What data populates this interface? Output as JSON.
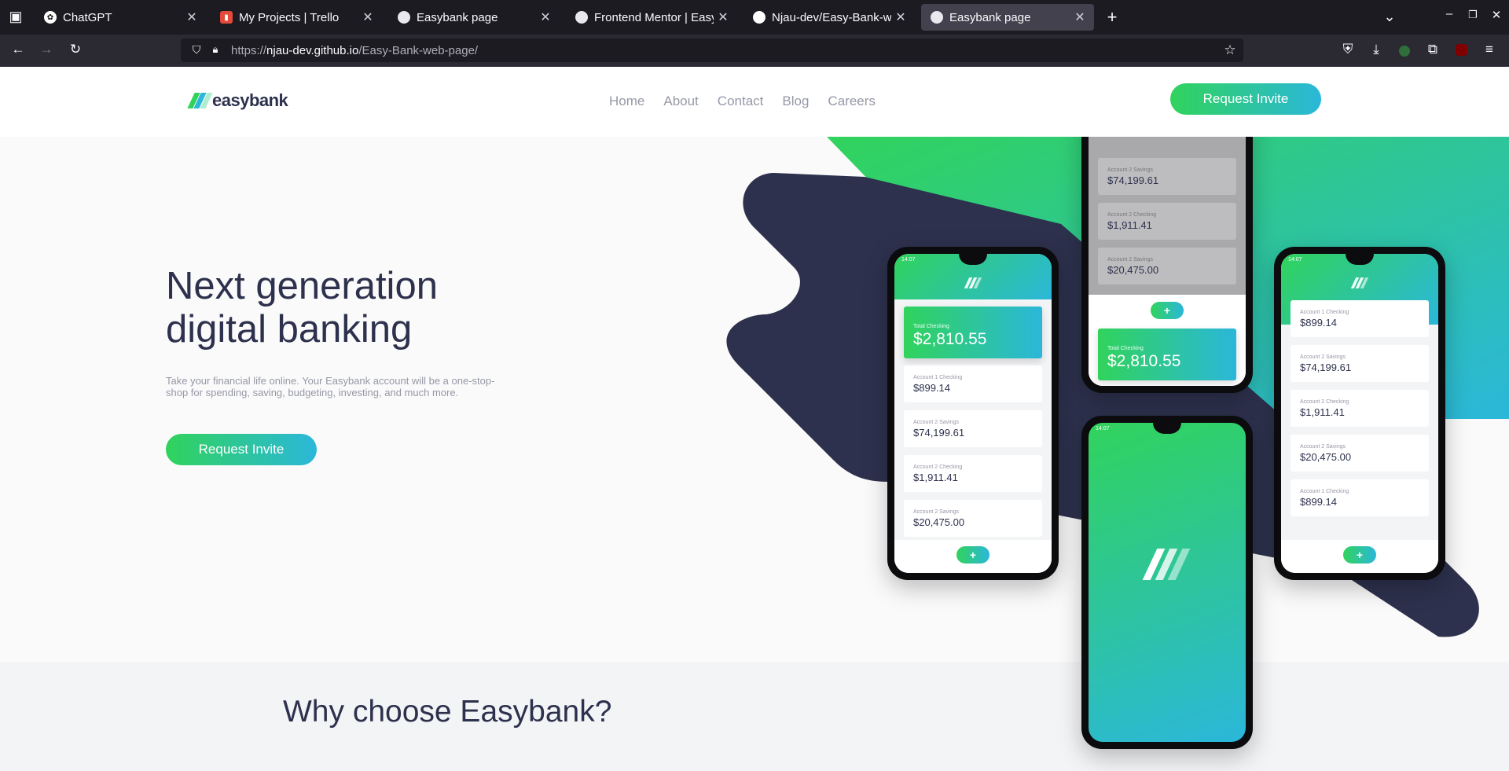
{
  "browser": {
    "tabs": [
      {
        "title": "ChatGPT",
        "favicon": "chatgpt-icon"
      },
      {
        "title": "My Projects | Trello",
        "favicon": "trello-icon"
      },
      {
        "title": "Easybank page",
        "favicon": "globe-icon"
      },
      {
        "title": "Frontend Mentor | Easyba",
        "favicon": "globe-icon"
      },
      {
        "title": "Njau-dev/Easy-Bank-web-",
        "favicon": "github-icon"
      },
      {
        "title": "Easybank page",
        "favicon": "globe-icon",
        "active": true
      }
    ],
    "url": {
      "scheme": "https://",
      "host": "njau-dev.github.io",
      "path": "/Easy-Bank-web-page/"
    }
  },
  "site": {
    "brand": "easybank",
    "nav": [
      "Home",
      "About",
      "Contact",
      "Blog",
      "Careers"
    ],
    "header_cta": "Request Invite",
    "hero": {
      "title_line1": "Next generation",
      "title_line2": "digital banking",
      "text": "Take your financial life online. Your Easybank account will be a one-stop-shop for spending, saving, budgeting, investing, and much more.",
      "cta": "Request Invite"
    },
    "why_title": "Why choose Easybank?",
    "colors": {
      "navy": "#2d314d",
      "green": "#31d35c",
      "cyan": "#2bb7da",
      "grey_text": "#9698a6"
    }
  },
  "mockups": {
    "clock": "14:07",
    "total_label": "Total Checking",
    "total_amount": "$2,810.55",
    "accounts": [
      {
        "label": "Account 1 Checking",
        "amount": "$899.14"
      },
      {
        "label": "Account 2 Savings",
        "amount": "$74,199.61"
      },
      {
        "label": "Account 2 Checking",
        "amount": "$1,911.41"
      },
      {
        "label": "Account 2 Savings",
        "amount": "$20,475.00"
      },
      {
        "label": "Account 1 Checking",
        "amount": "$899.14"
      }
    ],
    "fab_symbol": "+"
  }
}
